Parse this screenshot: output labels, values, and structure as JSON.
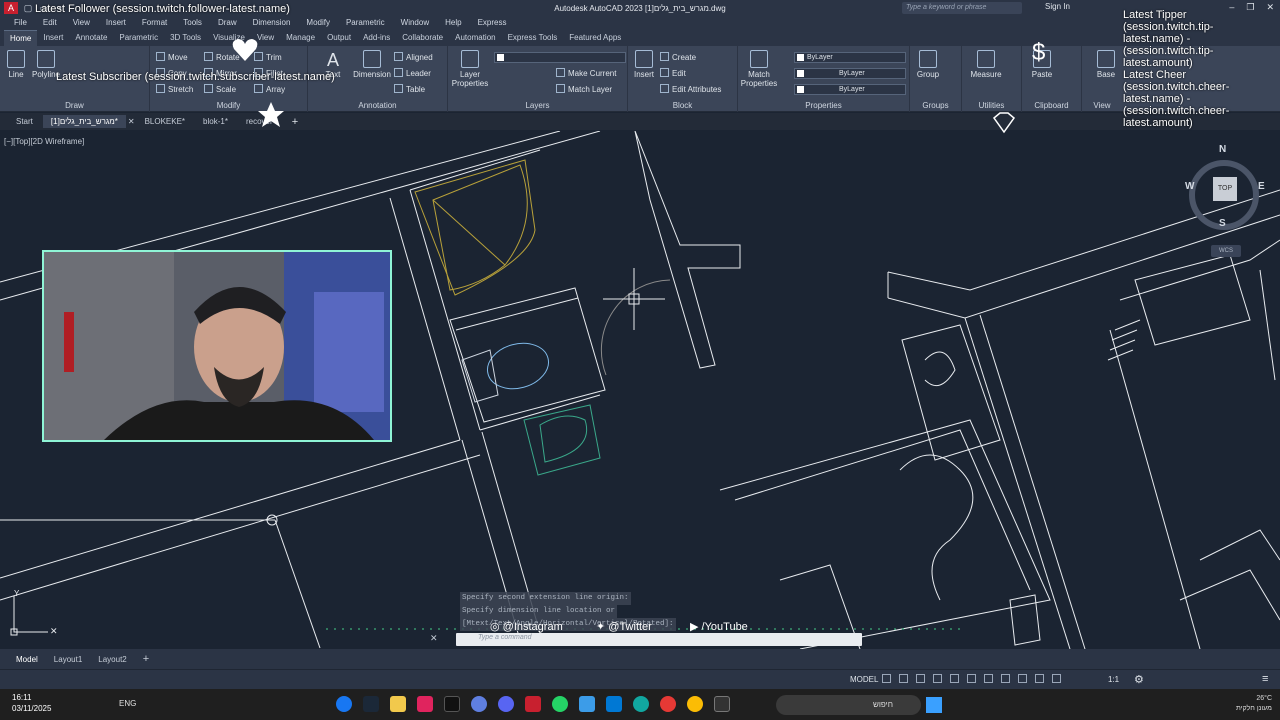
{
  "window": {
    "title": "Autodesk AutoCAD 2023  מגרש_בית_גלים[1].dwg",
    "search_placeholder": "Type a keyword or phrase",
    "sign_in": "Sign In"
  },
  "menu": [
    "File",
    "Edit",
    "View",
    "Insert",
    "Format",
    "Tools",
    "Draw",
    "Dimension",
    "Modify",
    "Parametric",
    "Window",
    "Help",
    "Express"
  ],
  "ribbon_tabs": [
    "Home",
    "Insert",
    "Annotate",
    "Parametric",
    "3D Tools",
    "Visualize",
    "View",
    "Manage",
    "Output",
    "Add-ins",
    "Collaborate",
    "Automation",
    "Express Tools",
    "Featured Apps"
  ],
  "ribbon": {
    "draw": {
      "title": "Draw",
      "line": "Line",
      "polyline": "Polyline"
    },
    "modify": {
      "title": "Modify",
      "move": "Move",
      "rotate": "Rotate",
      "trim": "Trim",
      "copy": "Copy",
      "mirror": "Mirror",
      "fillet": "Fillet",
      "stretch": "Stretch",
      "scale": "Scale",
      "array": "Array"
    },
    "annotation": {
      "title": "Annotation",
      "text": "Text",
      "dimension": "Dimension",
      "aligned": "Aligned",
      "leader": "Leader",
      "table": "Table"
    },
    "layers": {
      "title": "Layers",
      "layer_properties": "Layer Properties",
      "make_current": "Make Current",
      "match_layer": "Match Layer"
    },
    "block": {
      "title": "Block",
      "insert": "Insert",
      "create": "Create",
      "edit": "Edit",
      "edit_attributes": "Edit Attributes"
    },
    "properties": {
      "title": "Properties",
      "match_properties": "Match Properties",
      "color": "ByLayer",
      "linetype": "ByLayer",
      "lineweight": "ByLayer"
    },
    "groups": {
      "title": "Groups",
      "group": "Group"
    },
    "utilities": {
      "title": "Utilities",
      "measure": "Measure"
    },
    "clipboard": {
      "title": "Clipboard",
      "paste": "Paste"
    },
    "view": {
      "title": "View",
      "base": "Base"
    }
  },
  "file_tabs": [
    {
      "label": "Start",
      "active": false
    },
    {
      "label": "מגרש_בית_גלים[1]*",
      "active": true
    },
    {
      "label": "BLOKEKE*",
      "active": false
    },
    {
      "label": "blok-1*",
      "active": false
    },
    {
      "label": "recover*",
      "active": false
    }
  ],
  "viewport": {
    "label": "[−][Top][2D Wireframe]",
    "viewcube": {
      "top": "TOP",
      "n": "N",
      "s": "S",
      "e": "E",
      "w": "W"
    },
    "wcs": "WCS"
  },
  "command": {
    "history": [
      "Specify second extension line origin:",
      "Specify dimension line location or",
      "[Mtext/Text/Angle/Horizontal/Vertical/Rotated]:"
    ],
    "placeholder": "Type a command"
  },
  "social": {
    "instagram": "@Instagram",
    "twitter": "@Twitter",
    "youtube": "/YouTube"
  },
  "layout_tabs": [
    "Model",
    "Layout1",
    "Layout2"
  ],
  "status": {
    "model": "MODEL",
    "scale": "1:1"
  },
  "taskbar": {
    "time": "16:11",
    "date": "03/11/2025",
    "lang": "ENG",
    "search": "חיפוש",
    "tray_line1": "26°C",
    "tray_line2": "מעונן חלקית"
  },
  "overlay": {
    "follower": "Latest Follower (session.twitch.follower-latest.name)",
    "subscriber": "Latest Subscriber (session.twitch.subscriber-latest.name)",
    "tipper": "Latest Tipper (session.twitch.tip-latest.name) - (session.twitch.tip-latest.amount)",
    "cheer": "Latest Cheer (session.twitch.cheer-latest.name) - (session.twitch.cheer-latest.amount)"
  },
  "colors": {
    "canvas": "#1b2432",
    "ribbon": "#3b4558",
    "webcam_border": "#8ff5d6",
    "furniture": "#b8a13a",
    "sink": "#3aa88a",
    "toilet": "#7fb9e8"
  }
}
